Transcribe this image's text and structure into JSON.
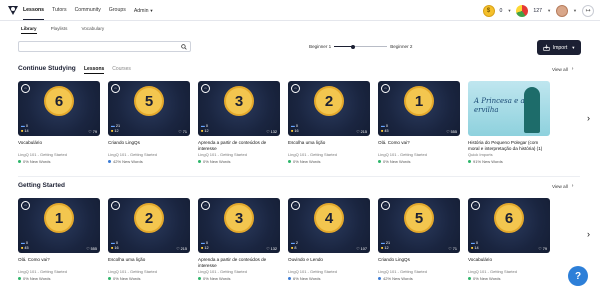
{
  "nav": {
    "items": [
      "Lessons",
      "Tutors",
      "Community",
      "Groups",
      "Admin"
    ],
    "active": "Lessons",
    "coins": "0",
    "streak": "127"
  },
  "library_tabs": [
    "Library",
    "Playlists",
    "Vocabulary"
  ],
  "search": {
    "placeholder": ""
  },
  "level": {
    "from": "Beginner 1",
    "to": "Beginner 2",
    "progress": 0.35
  },
  "import_label": "Import",
  "continue": {
    "title": "Continue Studying",
    "tabs": [
      "Lessons",
      "Courses"
    ],
    "view_all": "View all",
    "cards": [
      {
        "num": "6",
        "blue": "0",
        "yellow": "14",
        "likes": "79",
        "title": "Vocabulário",
        "sub": "LingQ 101 - Getting Started",
        "progress": "0% New Words"
      },
      {
        "num": "5",
        "blue": "21",
        "yellow": "12",
        "likes": "71",
        "title": "Criando LingQs",
        "sub": "LingQ 101 - Getting Started",
        "progress": "42% New Words"
      },
      {
        "num": "3",
        "blue": "0",
        "yellow": "12",
        "likes": "132",
        "title": "Aprenda a partir de conteúdos de interesse",
        "sub": "LingQ 101 - Getting Started",
        "progress": "0% New Words"
      },
      {
        "num": "2",
        "blue": "0",
        "yellow": "16",
        "likes": "215",
        "title": "Escolha uma lição",
        "sub": "LingQ 101 - Getting Started",
        "progress": "0% New Words"
      },
      {
        "num": "1",
        "blue": "0",
        "yellow": "45",
        "likes": "555",
        "title": "Olá. Como vai?",
        "sub": "LingQ 101 - Getting Started",
        "progress": "0% New Words"
      },
      {
        "num": "",
        "blue": "",
        "yellow": "",
        "likes": "",
        "title": "História do Pequeno Polegar (com moral e interpretação da história) (1)",
        "sub": "Quick Imports",
        "progress": "91% New Words",
        "princess": "A Princesa e a ervilha"
      }
    ]
  },
  "getting_started": {
    "title": "Getting Started",
    "view_all": "View all",
    "cards": [
      {
        "num": "1",
        "blue": "0",
        "yellow": "45",
        "likes": "555",
        "title": "Olá. Como vai?",
        "sub": "LingQ 101 - Getting Started",
        "progress": "0% New Words"
      },
      {
        "num": "2",
        "blue": "0",
        "yellow": "16",
        "likes": "215",
        "title": "Escolha uma lição",
        "sub": "LingQ 101 - Getting Started",
        "progress": "0% New Words"
      },
      {
        "num": "3",
        "blue": "0",
        "yellow": "12",
        "likes": "132",
        "title": "Aprenda a partir de conteúdos de interesse",
        "sub": "LingQ 101 - Getting Started",
        "progress": "0% New Words"
      },
      {
        "num": "4",
        "blue": "2",
        "yellow": "8",
        "likes": "107",
        "title": "Ouvindo e Lendo",
        "sub": "LingQ 101 - Getting Started",
        "progress": "6% New Words"
      },
      {
        "num": "5",
        "blue": "21",
        "yellow": "12",
        "likes": "71",
        "title": "Criando LingQs",
        "sub": "LingQ 101 - Getting Started",
        "progress": "42% New Words"
      },
      {
        "num": "6",
        "blue": "0",
        "yellow": "14",
        "likes": "79",
        "title": "Vocabulário",
        "sub": "LingQ 101 - Getting Started",
        "progress": "0% New Words"
      }
    ]
  },
  "help_label": "?"
}
